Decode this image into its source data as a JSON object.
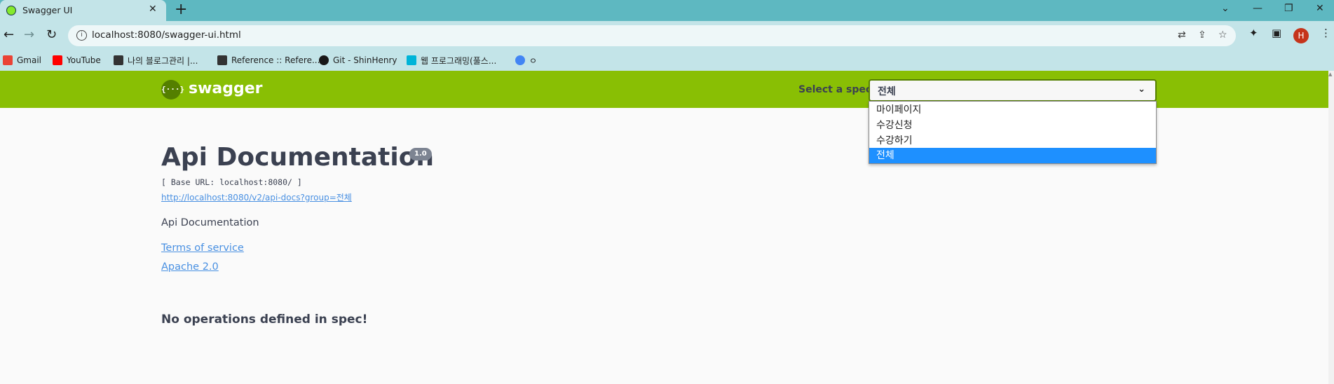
{
  "browser": {
    "tab": {
      "title": "Swagger UI",
      "close_glyph": "✕"
    },
    "new_tab_glyph": "+",
    "window_controls": {
      "dropdown": "⌄",
      "minimize": "—",
      "restore": "❐",
      "close": "✕"
    },
    "nav": {
      "back": "←",
      "forward": "→",
      "reload": "↻"
    },
    "url": "localhost:8080/swagger-ui.html",
    "omnibox_icons": [
      "translate-icon",
      "share-icon",
      "star-icon"
    ],
    "toolbar_icons": [
      "extensions-icon",
      "side-panel-icon",
      "menu-icon"
    ],
    "profile_initial": "H",
    "bookmarks": [
      {
        "label": "Gmail",
        "icon": "gmail-icon",
        "color": "#ea4335"
      },
      {
        "label": "YouTube",
        "icon": "youtube-icon",
        "color": "#ff0000"
      },
      {
        "label": "나의 블로그관리 |...",
        "icon": "tistory-icon",
        "color": "#333333"
      },
      {
        "label": "Reference :: Refere...",
        "icon": "tistory-icon",
        "color": "#333333"
      },
      {
        "label": "Git - ShinHenry",
        "icon": "github-icon",
        "color": "#181717"
      },
      {
        "label": "웹 프로그래밍(풀스...",
        "icon": "site-icon",
        "color": "#00b4d8"
      },
      {
        "label": "",
        "icon": "google-icon",
        "color": "#4285f4"
      },
      {
        "label": "ㅇ",
        "icon": "",
        "color": ""
      }
    ]
  },
  "swagger": {
    "logo_symbol": "{···}",
    "logo_text": "swagger",
    "select_label": "Select a spec",
    "selected_spec": "전체",
    "spec_options": [
      "마이페이지",
      "수강신청",
      "수강하기",
      "전체"
    ],
    "title": "Api Documentation",
    "version": "1.0",
    "base_url": "[ Base URL: localhost:8080/ ]",
    "spec_url": "http://localhost:8080/v2/api-docs?group=전체",
    "description": "Api Documentation",
    "terms_link": "Terms of service",
    "license_link": "Apache 2.0",
    "no_operations": "No operations defined in spec!"
  },
  "colors": {
    "topbar": "#89bf04",
    "accent_dark": "#547f00",
    "link": "#4990e2",
    "selected_option": "#1e90ff",
    "text": "#3b4151"
  }
}
